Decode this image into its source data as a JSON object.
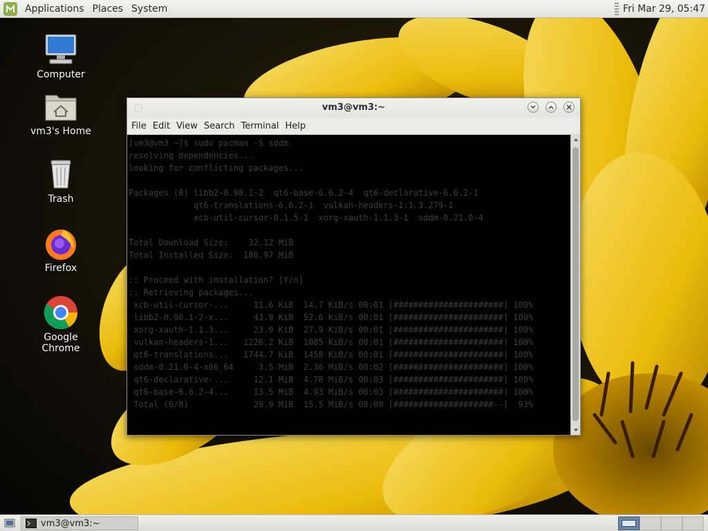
{
  "top_panel": {
    "menus": [
      "Applications",
      "Places",
      "System"
    ],
    "clock": "Fri Mar 29, 05:47"
  },
  "desktop_icons": [
    {
      "label": "Computer",
      "icon": "computer-icon"
    },
    {
      "label": "vm3's Home",
      "icon": "home-folder-icon"
    },
    {
      "label": "Trash",
      "icon": "trash-icon"
    },
    {
      "label": "Firefox",
      "icon": "firefox-icon"
    },
    {
      "label": "Google Chrome",
      "icon": "chrome-icon"
    }
  ],
  "terminal": {
    "title": "vm3@vm3:~",
    "menu": [
      "File",
      "Edit",
      "View",
      "Search",
      "Terminal",
      "Help"
    ],
    "output": "[vm3@vm3 ~]$ sudo pacman -S sddm\nresolving dependencies...\nlooking for conflicting packages...\n\nPackages (8) libb2-0.98.1-2  qt6-base-6.6.2-4  qt6-declarative-6.6.2-1\n             qt6-translations-6.6.2-1  vulkan-headers-1:1.3.279-1\n             xcb-util-cursor-0.1.5-1  xorg-xauth-1.1.3-1  sddm-0.21.0-4\n\nTotal Download Size:    32.12 MiB\nTotal Installed Size:  180.97 MiB\n\n:: Proceed with installation? [Y/n]\n:: Retrieving packages...\n xcb-util-cursor-...     11.6 KiB  14.7 KiB/s 00:01 [######################] 100%\n libb2-0.98.1-2-x...     43.9 KiB  52.6 KiB/s 00:01 [######################] 100%\n xorg-xauth-1.1.3...     23.9 KiB  27.9 KiB/s 00:01 [######################] 100%\n vulkan-headers-1...   1226.2 KiB  1085 KiB/s 00:01 [######################] 100%\n qt6-translations...   1744.7 KiB  1458 KiB/s 00:01 [######################] 100%\n sddm-0.21.0-4-x86_64     3.5 MiB  2.36 MiB/s 00:02 [######################] 100%\n qt6-declarative-...     12.1 MiB  4.78 MiB/s 00:03 [######################] 100%\n qt6-base-6.6.2-4...     13.5 MiB  4.93 MiB/s 00:03 [######################] 100%\n Total (6/8)             29.9 MiB  15.5 MiB/s 00:00 [####################--]  93%"
  },
  "taskbar": {
    "window_button": "vm3@vm3:~"
  }
}
